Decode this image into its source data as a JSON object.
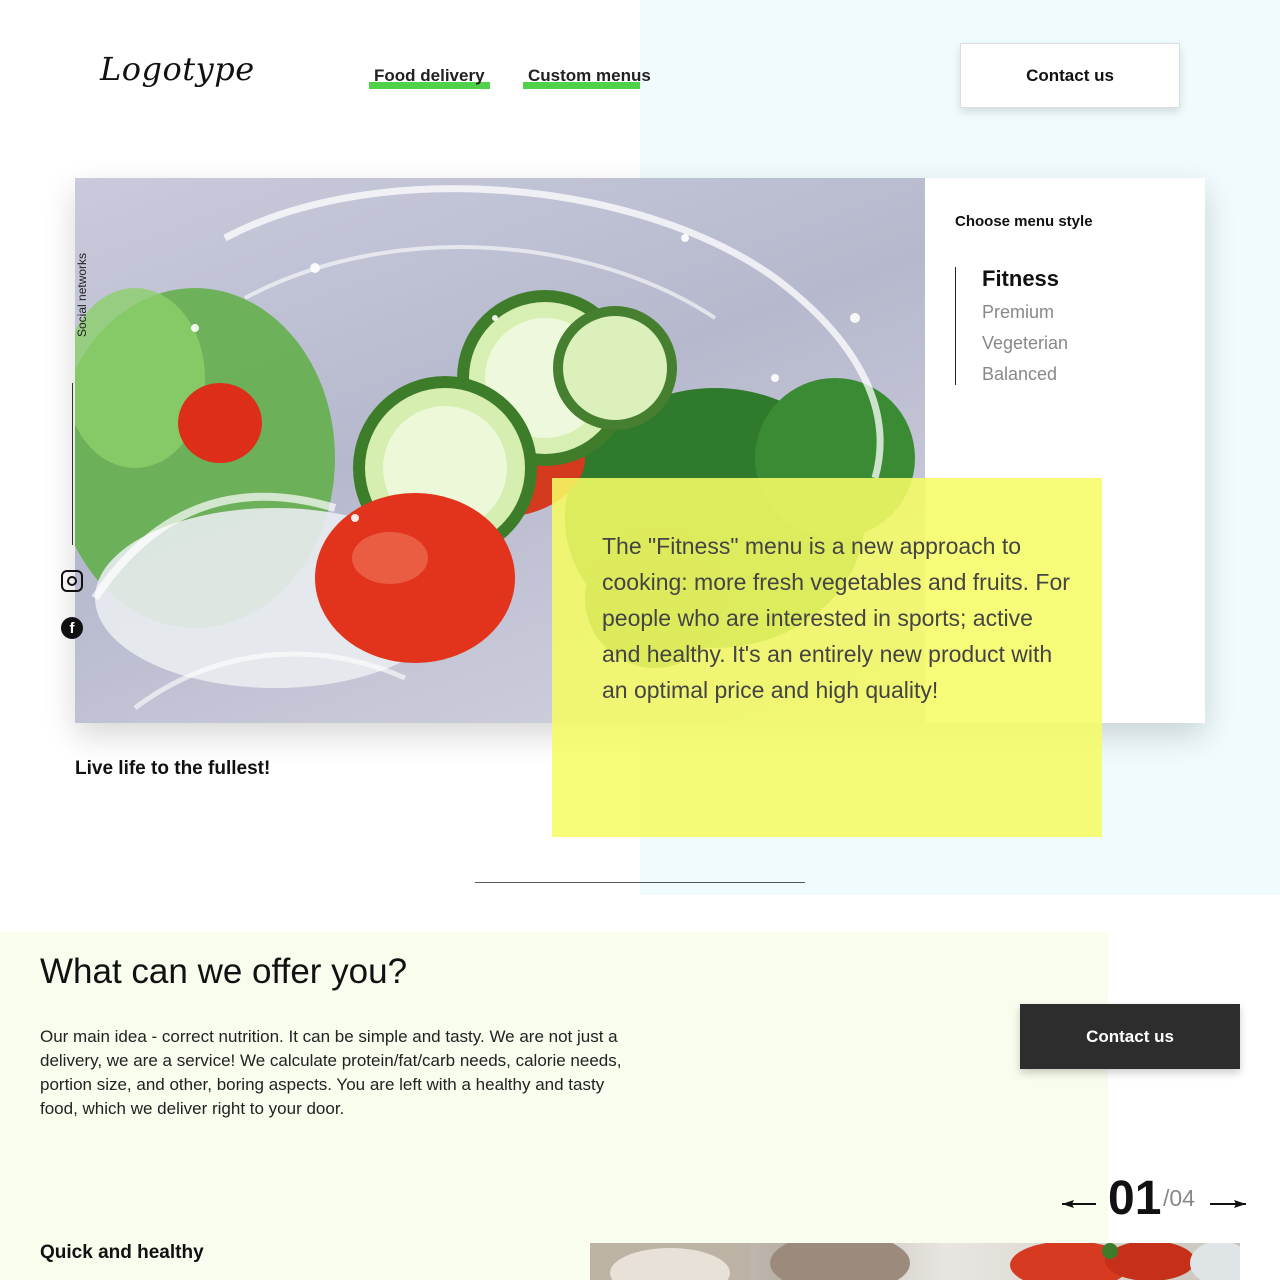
{
  "header": {
    "logo": "Logotype",
    "nav": [
      {
        "label": "Food delivery"
      },
      {
        "label": "Custom menus"
      }
    ],
    "contact_button": "Contact us"
  },
  "hero": {
    "social_label": "Social networks",
    "menu_style": {
      "title": "Choose menu style",
      "items": [
        "Fitness",
        "Premium",
        "Vegeterian",
        "Balanced"
      ],
      "active": "Fitness"
    },
    "description": "The \"Fitness\" menu is a new approach to cooking: more fresh vegetables and fruits. For people who are interested in sports; active and healthy. It's an entirely new product with an optimal price and high quality!",
    "slogan": "Live life to the fullest!"
  },
  "offer": {
    "title": "What can we offer you?",
    "text": "Our main idea - correct nutrition. It can be simple and tasty. We are not just a delivery, we are a service! We calculate protein/fat/carb needs, calorie needs, portion size, and other, boring aspects. You are left with a healthy and tasty food, which we deliver right to your door.",
    "contact_button": "Contact us"
  },
  "pager": {
    "current": "01",
    "total": "/04"
  },
  "feature": {
    "title": "Quick and healthy"
  },
  "colors": {
    "accent_green": "#4fd14a",
    "highlight_yellow": "#f5fc64",
    "right_panel_bg": "#effbfc",
    "offer_bg": "#f8fdee",
    "dark_button": "#2d2d2d"
  }
}
